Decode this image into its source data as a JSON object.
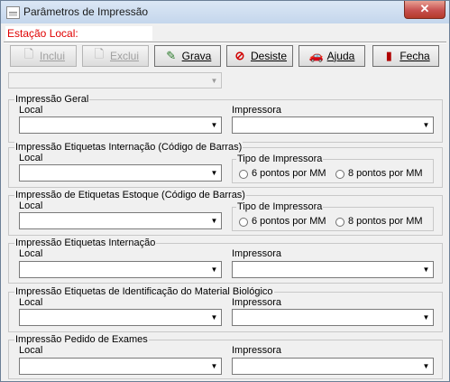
{
  "window": {
    "title": "Parâmetros de Impressão",
    "close_glyph": "✕"
  },
  "station_label": "Estação Local:",
  "toolbar": {
    "buttons": [
      {
        "label": "Inclui",
        "icon": "file-new-icon",
        "glyph": "🗋",
        "enabled": false
      },
      {
        "label": "Exclui",
        "icon": "delete-icon",
        "glyph": "🗋",
        "enabled": false
      },
      {
        "label": "Grava",
        "icon": "save-icon",
        "glyph": "✎",
        "enabled": true
      },
      {
        "label": "Desiste",
        "icon": "cancel-icon",
        "glyph": "⊘",
        "enabled": true
      },
      {
        "label": "Ajuda",
        "icon": "help-icon",
        "glyph": "🚗",
        "enabled": true
      },
      {
        "label": "Fecha",
        "icon": "exit-icon",
        "glyph": "▮",
        "enabled": true
      }
    ]
  },
  "top_select": {
    "value": "",
    "enabled": false
  },
  "groups": [
    {
      "title": "Impressão Geral",
      "local_label": "Local",
      "local_value": "",
      "kind": "printer",
      "printer_label": "Impressora",
      "printer_value": ""
    },
    {
      "title": "Impressão Etiquetas Internação (Código de Barras)",
      "local_label": "Local",
      "local_value": "",
      "kind": "type",
      "type_title": "Tipo de Impressora",
      "options": [
        "6 pontos por MM",
        "8 pontos por MM"
      ]
    },
    {
      "title": "Impressão de Etiquetas Estoque (Código de Barras)",
      "local_label": "Local",
      "local_value": "",
      "kind": "type",
      "type_title": "Tipo de Impressora",
      "options": [
        "6 pontos por MM",
        "8 pontos por MM"
      ]
    },
    {
      "title": "Impressão Etiquetas Internação",
      "local_label": "Local",
      "local_value": "",
      "kind": "printer",
      "printer_label": "Impressora",
      "printer_value": ""
    },
    {
      "title": "Impressão Etiquetas de Identificação do Material Biológico",
      "local_label": "Local",
      "local_value": "",
      "kind": "printer",
      "printer_label": "Impressora",
      "printer_value": ""
    },
    {
      "title": "Impressão Pedido de Exames",
      "local_label": "Local",
      "local_value": "",
      "kind": "printer",
      "printer_label": "Impressora",
      "printer_value": ""
    }
  ]
}
